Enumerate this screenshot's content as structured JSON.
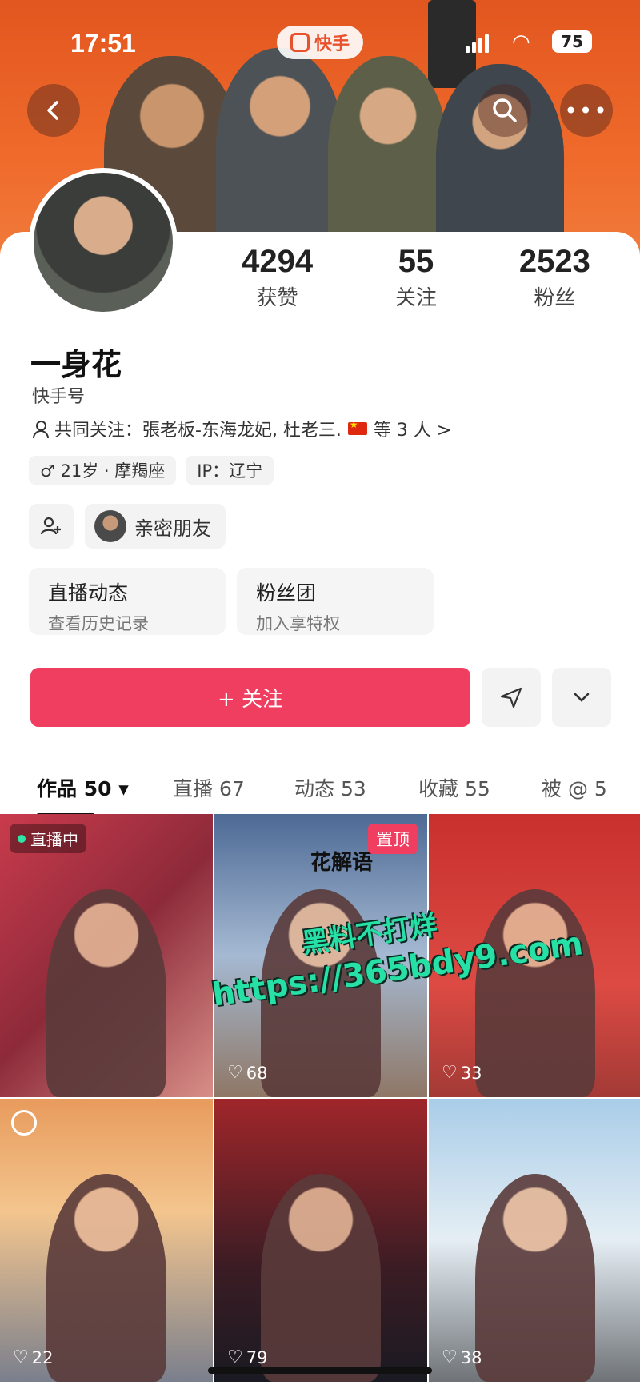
{
  "status_bar": {
    "time": "17:51",
    "app_name": "快手",
    "battery": "75"
  },
  "nav": {
    "back_icon": "chevron-left-icon",
    "search_icon": "search-icon",
    "more_icon": "more-dots-icon"
  },
  "stats": [
    {
      "value": "4294",
      "label": "获赞"
    },
    {
      "value": "55",
      "label": "关注"
    },
    {
      "value": "2523",
      "label": "粉丝"
    }
  ],
  "profile": {
    "name": "一身花",
    "kuaishou_id": "快手号",
    "mutual_follow": "共同关注：張老板-东海龙妃, 杜老三.",
    "mutual_suffix": "等 3 人 >",
    "tag_age": "♂ 21岁 · 摩羯座",
    "tag_ip": "IP：辽宁",
    "close_friend": "亲密朋友"
  },
  "features": [
    {
      "title": "直播动态",
      "sub": "查看历史记录"
    },
    {
      "title": "粉丝团",
      "sub": "加入享特权"
    }
  ],
  "actions": {
    "follow_label": "+ 关注",
    "accent_color": "#f03e60"
  },
  "tabs": [
    {
      "label": "作品 50 ▾"
    },
    {
      "label": "直播 67"
    },
    {
      "label": "动态 53"
    },
    {
      "label": "收藏 55"
    },
    {
      "label": "被 @ 5"
    }
  ],
  "grid": [
    {
      "badge": "直播中",
      "likes": ""
    },
    {
      "badge": "置顶",
      "overlay": "花解语",
      "likes": "68"
    },
    {
      "likes": "33"
    },
    {
      "likes": "22"
    },
    {
      "likes": "79"
    },
    {
      "likes": "38"
    }
  ],
  "watermark": {
    "line1": "黑料不打烊",
    "line2": "https://365bdy9.com"
  }
}
